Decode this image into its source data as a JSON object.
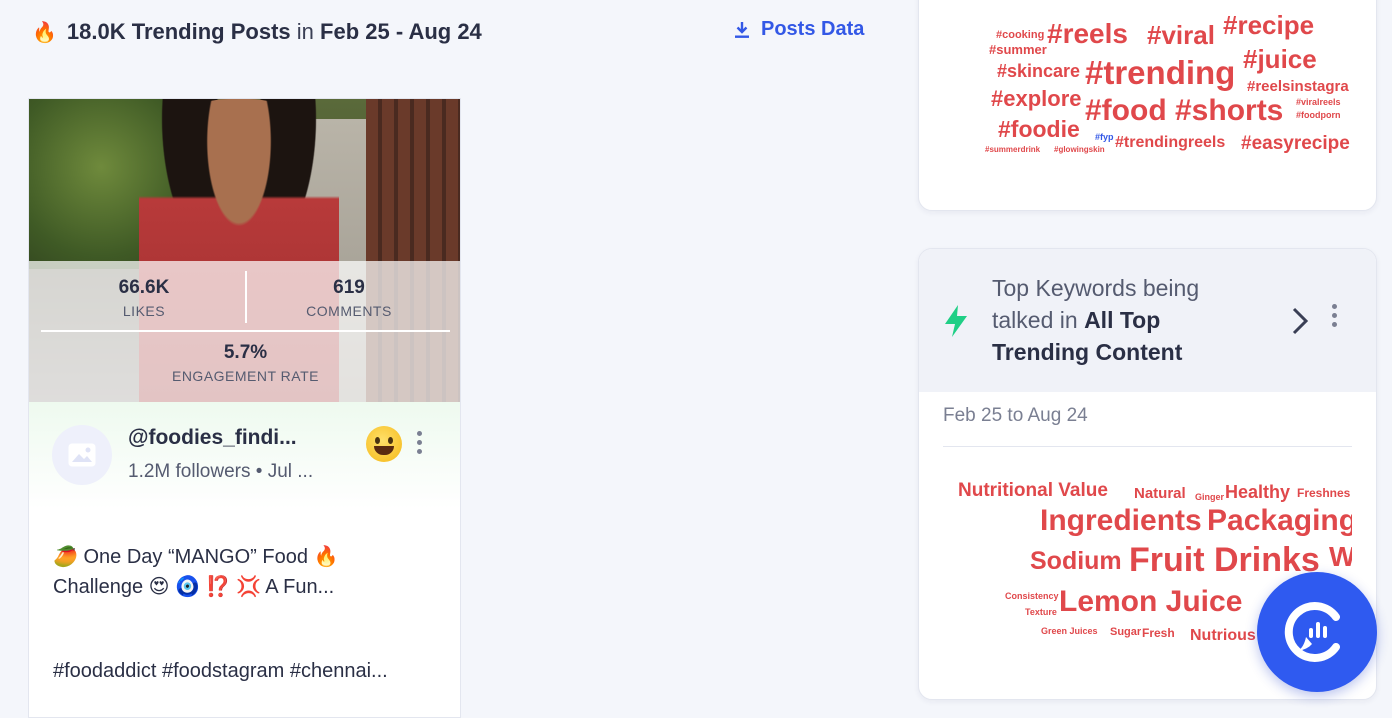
{
  "header": {
    "count": "18.0K Trending Posts",
    "in_word": "in",
    "range": "Feb 25 - Aug 24",
    "posts_data_label": "Posts Data"
  },
  "post": {
    "stats": {
      "likes_value": "66.6K",
      "likes_label": "LIKES",
      "comments_value": "619",
      "comments_label": "COMMENTS",
      "engagement_value": "5.7%",
      "engagement_label": "ENGAGEMENT RATE"
    },
    "author": "@foodies_findi...",
    "meta": "1.2M followers • Jul ...",
    "caption_line1": "🥭 One Day “MANGO” Food 🔥",
    "caption_line2": "Challenge 😍 🧿 ⁉️ 💢 A Fun...",
    "hashtags": "#foodaddict #foodstagram #chennai..."
  },
  "hashtag_cloud": [
    {
      "text": "#cooking"
    },
    {
      "text": "#reels"
    },
    {
      "text": "#viral"
    },
    {
      "text": "#recipe"
    },
    {
      "text": "#summer"
    },
    {
      "text": "#skincare"
    },
    {
      "text": "#trending"
    },
    {
      "text": "#juice"
    },
    {
      "text": "#reelsinstagra"
    },
    {
      "text": "#explore"
    },
    {
      "text": "#food"
    },
    {
      "text": "#shorts"
    },
    {
      "text": "#viralreels"
    },
    {
      "text": "#foodporn"
    },
    {
      "text": "#foodie"
    },
    {
      "text": "#fyp"
    },
    {
      "text": "#trendingreels"
    },
    {
      "text": "#easyrecipe"
    },
    {
      "text": "#summerdrink"
    },
    {
      "text": "#glowingskin"
    }
  ],
  "keywords_card": {
    "title_prefix": "Top Keywords being talked in ",
    "title_bold": "All Top Trending Content",
    "date": "Feb 25 to Aug 24"
  },
  "keyword_cloud": [
    {
      "text": "Nutritional Value"
    },
    {
      "text": "Natural"
    },
    {
      "text": "Ginger"
    },
    {
      "text": "Healthy"
    },
    {
      "text": "Freshnes"
    },
    {
      "text": "Ingredients"
    },
    {
      "text": "Packaging"
    },
    {
      "text": "Sodium"
    },
    {
      "text": "Fruit Drinks"
    },
    {
      "text": "W"
    },
    {
      "text": "Consistency"
    },
    {
      "text": "Lemon Juice"
    },
    {
      "text": "Texture"
    },
    {
      "text": "Green Juices"
    },
    {
      "text": "Sugar"
    },
    {
      "text": "Fresh"
    },
    {
      "text": "Nutrious"
    }
  ],
  "colors": {
    "accent": "#3358e6",
    "cloud_red": "#e0484b",
    "bolt_green": "#1fcf86"
  }
}
